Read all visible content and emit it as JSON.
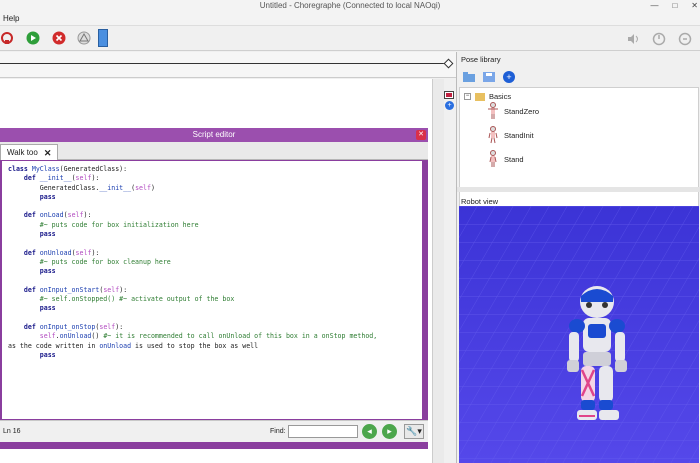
{
  "window": {
    "title": "Untitled - Choregraphe (Connected to local NAOqi)"
  },
  "menu": {
    "help_label": "Help"
  },
  "colors": {
    "accent_purple": "#8a3e9e",
    "robot_view_bg": "#4a3ee0",
    "run_green": "#2e9e3a",
    "stop_red": "#d12b2b"
  },
  "script_editor": {
    "title": "Script editor",
    "tab_label": "Walk too",
    "status_line": "Ln 16",
    "find_label": "Find:",
    "code_lines": [
      "class MyClass(GeneratedClass):",
      "    def __init__(self):",
      "        GeneratedClass.__init__(self)",
      "        pass",
      "",
      "    def onLoad(self):",
      "        #~ puts code for box initialization here",
      "        pass",
      "",
      "    def onUnload(self):",
      "        #~ puts code for box cleanup here",
      "        pass",
      "",
      "    def onInput_onStart(self):",
      "        #~ self.onStopped() #~ activate output of the box",
      "        pass",
      "",
      "    def onInput_onStop(self):",
      "        self.onUnload() #~ it is recommended to call onUnload of this box in a onStop method,",
      "as the code written in onUnload is used to stop the box as well",
      "        pass"
    ]
  },
  "pose_library": {
    "title": "Pose library",
    "root_label": "Basics",
    "items": [
      "StandZero",
      "StandInit",
      "Stand"
    ]
  },
  "robot_view": {
    "title": "Robot view"
  },
  "icons": {
    "toolbar_left": [
      "connect-icon",
      "play-icon",
      "stop-icon",
      "warning-icon",
      "box-icon"
    ],
    "toolbar_right": [
      "volume-icon",
      "robot-wake-icon",
      "robot-rest-icon"
    ]
  }
}
